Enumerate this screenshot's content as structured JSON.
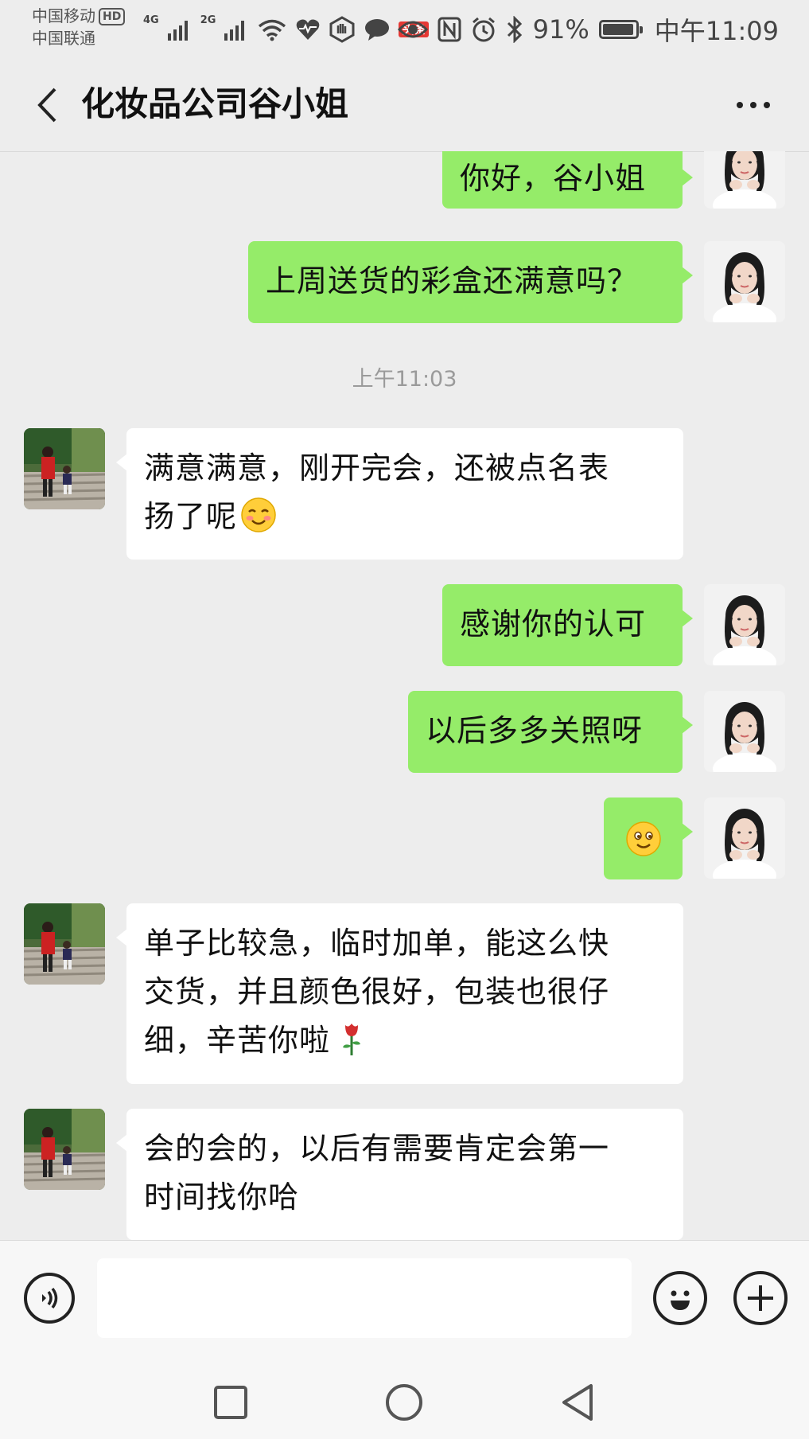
{
  "status_bar": {
    "carrier_1": "中国移动",
    "carrier_1_badge": "HD",
    "carrier_2": "中国联通",
    "network_1": "4G",
    "network_2": "2G",
    "toutiao_badge": "头条",
    "battery": "91%",
    "time": "中午11:09"
  },
  "header": {
    "title": "化妆品公司谷小姐"
  },
  "messages": [
    {
      "side": "out",
      "text": "你好，谷小姐"
    },
    {
      "side": "out",
      "text": "上周送货的彩盒还满意吗？"
    },
    {
      "type": "time",
      "text": "上午11:03"
    },
    {
      "side": "in",
      "text_line1": "满意满意，刚开完会，还被点名表",
      "text_line2": "扬了呢",
      "emoji": "blush-emoji"
    },
    {
      "side": "out",
      "text": "感谢你的认可"
    },
    {
      "side": "out",
      "text": "以后多多关照呀"
    },
    {
      "side": "out",
      "emoji": "smile-emoji"
    },
    {
      "side": "in",
      "text_line1": "单子比较急，临时加单，能这么快",
      "text_line2": "交货，并且颜色很好，包装也很仔",
      "text_line3": "细，辛苦你啦",
      "emoji": "rose-emoji"
    },
    {
      "side": "in",
      "text_line1": "会的会的，以后有需要肯定会第一",
      "text_line2": "时间找你哈"
    }
  ],
  "input_bar": {
    "placeholder": "",
    "value": "",
    "voice_icon": "voice-icon",
    "emoji_icon": "emoji-icon",
    "plus_icon": "plus-icon"
  },
  "colors": {
    "outgoing_bubble": "#95ec69",
    "incoming_bubble": "#ffffff",
    "background": "#ededed"
  }
}
